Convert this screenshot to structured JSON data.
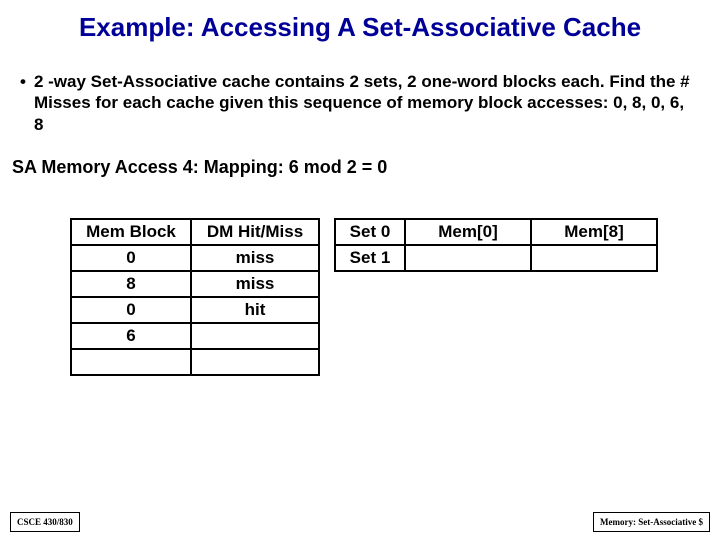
{
  "title": "Example: Accessing A Set-Associative Cache",
  "bullet": "2 -way Set-Associative cache contains 2 sets, 2 one-word blocks each. Find the # Misses for each cache given this sequence of memory block accesses: 0, 8, 0, 6, 8",
  "access_line": "SA Memory Access 4:  Mapping: 6 mod 2 = 0",
  "table1": {
    "headers": [
      "Mem Block",
      "DM Hit/Miss"
    ],
    "rows": [
      [
        "0",
        "miss"
      ],
      [
        "8",
        "miss"
      ],
      [
        "0",
        "hit"
      ],
      [
        "6",
        ""
      ],
      [
        "",
        ""
      ]
    ]
  },
  "table2": {
    "rows": [
      [
        "Set 0",
        "Mem[0]",
        "Mem[8]"
      ],
      [
        "Set 1",
        "",
        ""
      ]
    ]
  },
  "footer_left": "CSCE 430/830",
  "footer_right": "Memory: Set-Associative $"
}
